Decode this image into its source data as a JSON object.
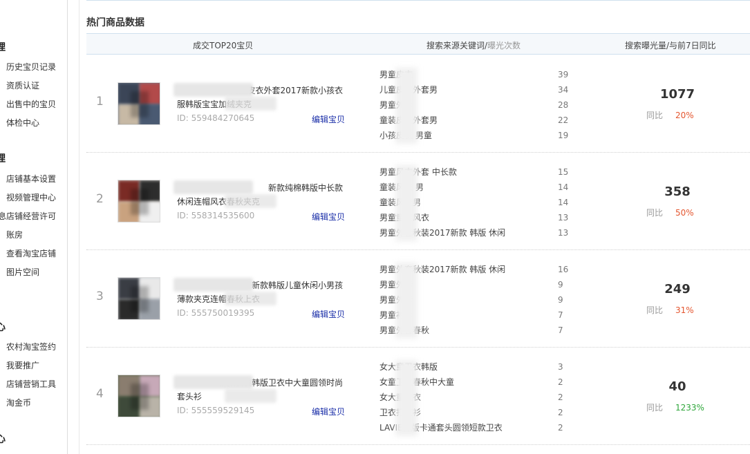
{
  "sidebar": {
    "sections": [
      {
        "head": "理",
        "items": [
          "历史宝贝记录",
          "资质认证",
          "出售中的宝贝",
          "体检中心"
        ]
      },
      {
        "head": "理",
        "items": [
          "店铺基本设置",
          "视频管理中心",
          "息店铺经营许可",
          "账房",
          "查看淘宝店铺",
          "图片空间"
        ]
      },
      {
        "head": "心",
        "items": [
          "农村淘宝签约",
          "我要推广",
          "店铺营销工具",
          "淘金币"
        ]
      },
      {
        "head": "心",
        "items": []
      }
    ]
  },
  "main": {
    "section_title": "热门商品数据",
    "table_header": {
      "col1": "成交TOP20宝贝",
      "col2_main": "搜索来源关键词/",
      "col2_sub": "曝光次数",
      "col3": "搜索曝光量/与前7日同比"
    },
    "edit_label": "编辑宝贝",
    "compare_label": "同比",
    "rows": [
      {
        "rank": "1",
        "title_line1": "儿童皮衣外套2017新款小孩衣",
        "title_line2": "服韩版宝宝加绒夹克",
        "id_text": "ID: 559484270645",
        "keywords": [
          {
            "text": "男童皮衣",
            "count": "39"
          },
          {
            "text": "儿童皮衣外套男",
            "count": "34"
          },
          {
            "text": "男童外套",
            "count": "28"
          },
          {
            "text": "童装皮衣外套男",
            "count": "22"
          },
          {
            "text": "小孩皮衣 男童",
            "count": "19"
          }
        ],
        "exposure": "1077",
        "pct": "20%",
        "pct_color": "#e4562f"
      },
      {
        "rank": "2",
        "title_line1": "新款纯棉韩版中长款",
        "title_line2": "休闲连帽风衣春秋夹克",
        "id_text": "ID: 558314535600",
        "keywords": [
          {
            "text": "男童风衣外套 中长款",
            "count": "15"
          },
          {
            "text": "童装风衣 男",
            "count": "14"
          },
          {
            "text": "童装风衣男",
            "count": "14"
          },
          {
            "text": "男童童装风衣",
            "count": "13"
          },
          {
            "text": "男童外套秋装2017新款 韩版 休闲",
            "count": "13"
          }
        ],
        "exposure": "358",
        "pct": "50%",
        "pct_color": "#e4562f"
      },
      {
        "rank": "3",
        "title_line1": "新款韩版儿童休闲小男孩",
        "title_line2": "薄款夹克连帽春秋上衣",
        "id_text": "ID: 555750019395",
        "keywords": [
          {
            "text": "男童外套秋装2017新款 韩版 休闲",
            "count": "16"
          },
          {
            "text": "男童外套",
            "count": "9"
          },
          {
            "text": "男童外套",
            "count": "9"
          },
          {
            "text": "男童衬衫",
            "count": "7"
          },
          {
            "text": "男童外套春秋",
            "count": "7"
          }
        ],
        "exposure": "249",
        "pct": "31%",
        "pct_color": "#e4562f"
      },
      {
        "rank": "4",
        "title_line1": "2017新款秋装韩版卫衣中大童圆领时尚",
        "title_line2": "套头衫",
        "id_text": "ID: 555559529145",
        "keywords": [
          {
            "text": "女大童卫衣韩版",
            "count": "3"
          },
          {
            "text": "女童卫衣春秋中大童",
            "count": "2"
          },
          {
            "text": "女大童卫衣",
            "count": "2"
          },
          {
            "text": "卫衣打底衫",
            "count": "2"
          },
          {
            "text": "LAVIE韩版卡通套头圆领短款卫衣",
            "count": "2"
          }
        ],
        "exposure": "40",
        "pct": "1233%",
        "pct_color": "#2ea63a"
      }
    ]
  }
}
